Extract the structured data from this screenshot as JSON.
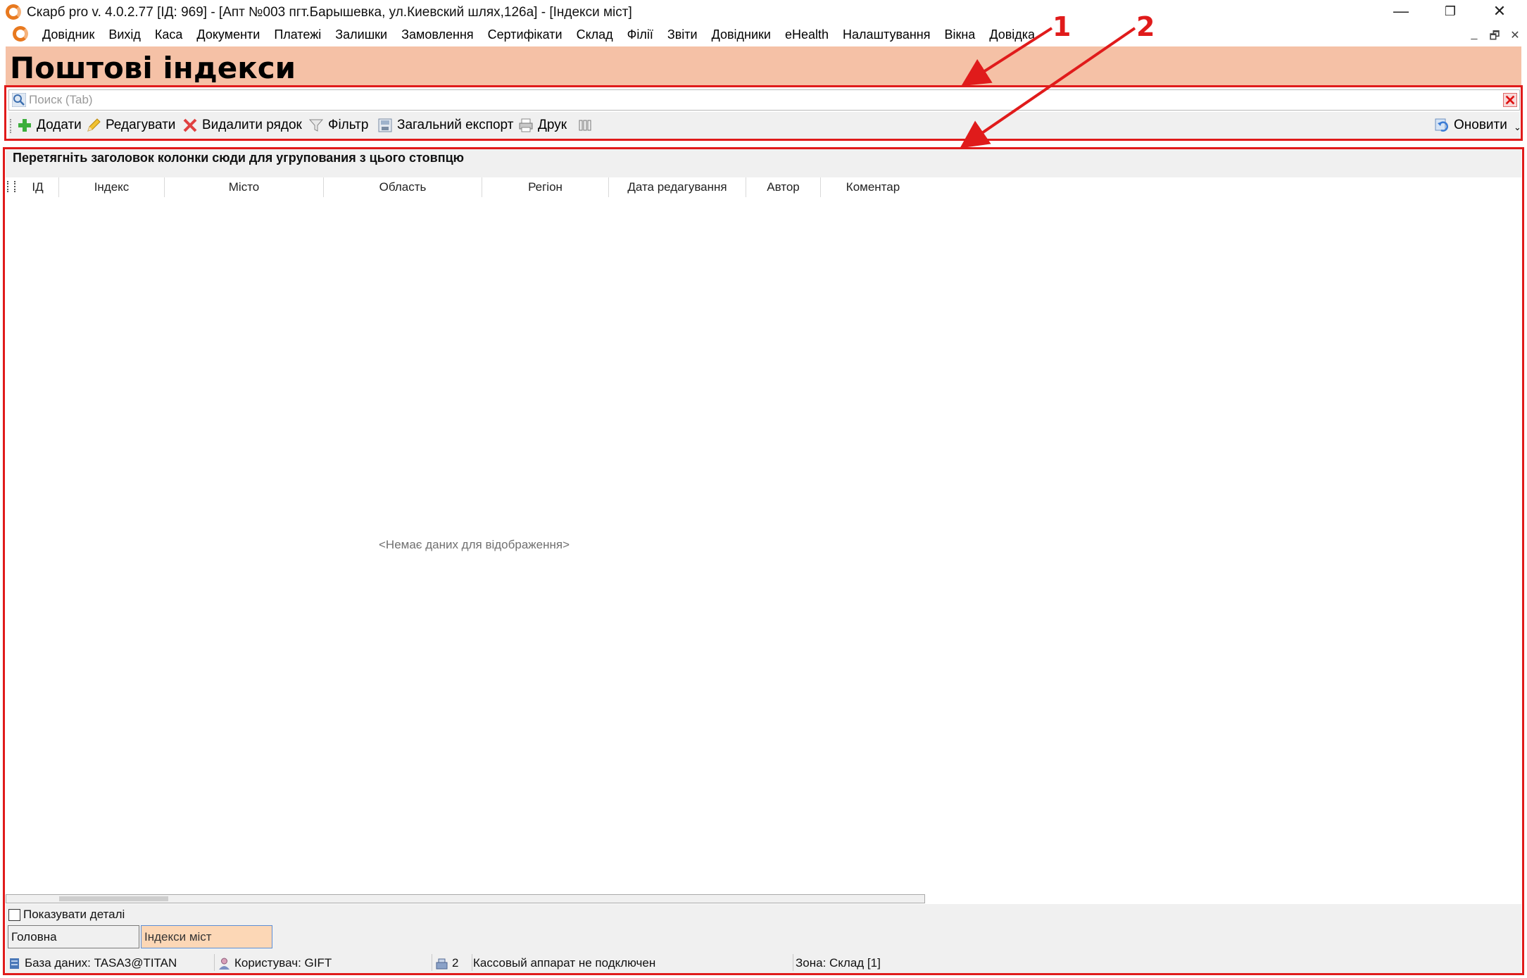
{
  "window": {
    "title": "Скарб pro v. 4.0.2.77 [ІД: 969] - [Апт №003 пгт.Барышевка, ул.Киевский шлях,126а] - [Індекси міст]",
    "minimize": "—",
    "maximize": "❐",
    "close": "✕"
  },
  "menu": {
    "items": [
      "Довідник",
      "Вихід",
      "Каса",
      "Документи",
      "Платежі",
      "Залишки",
      "Замовлення",
      "Сертифікати",
      "Склад",
      "Філії",
      "Звіти",
      "Довідники",
      "eHealth",
      "Налаштування",
      "Вікна",
      "Довідка"
    ],
    "mdi_min": "_",
    "mdi_restore": "🗗",
    "mdi_close": "✕"
  },
  "page": {
    "title": "Поштові індекси"
  },
  "annotations": {
    "callout_1": "1",
    "callout_2": "2",
    "color": "#e01b1b"
  },
  "search": {
    "placeholder": "Поиск (Tab)",
    "value": ""
  },
  "toolbar": {
    "add": "Додати",
    "edit": "Редагувати",
    "delete": "Видалити рядок",
    "filter": "Фільтр",
    "export": "Загальний експорт",
    "print": "Друк",
    "refresh": "Оновити"
  },
  "grid": {
    "group_panel_text": "Перетягніть заголовок колонки сюди для угрупования з цього стовпцю",
    "columns": [
      "ІД",
      "Індекс",
      "Місто",
      "Область",
      "Регіон",
      "Дата редагування",
      "Автор",
      "Коментар"
    ],
    "rows": [],
    "empty_text": "<Немає даних для відображення>"
  },
  "bottom": {
    "show_details_label": "Показувати деталі",
    "show_details_checked": false,
    "tabs": [
      {
        "label": "Головна",
        "active": false
      },
      {
        "label": "Індекси міст",
        "active": true
      }
    ]
  },
  "status": {
    "database": "База даних: TASA3@TITAN",
    "user": "Користувач: GIFT",
    "count": "2",
    "cash_register": "Кассовый аппарат не подключен",
    "zone": "Зона: Склад [1]"
  },
  "colors": {
    "header_bg": "#f5c1a6",
    "active_tab_bg": "#fcd7b6",
    "annotation_red": "#e01b1b"
  }
}
